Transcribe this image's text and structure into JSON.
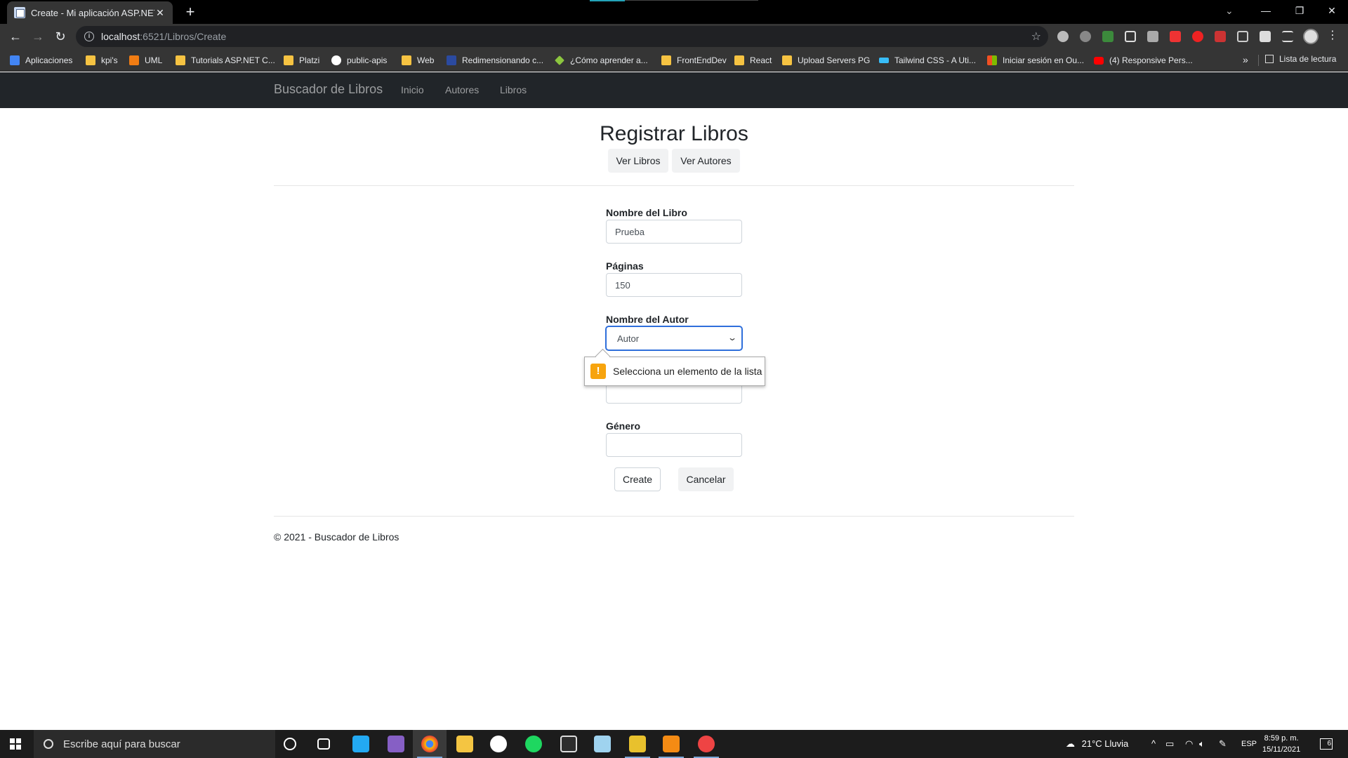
{
  "browser": {
    "tab_title": "Create - Mi aplicación ASP.NET",
    "tab_close": "✕",
    "new_tab": "+",
    "url_host": "localhost",
    "url_rest": ":6521/Libros/Create",
    "bookmarks": [
      {
        "label": "Aplicaciones",
        "icon": "apps-grid-icon",
        "color": "#4285f4"
      },
      {
        "label": "kpi's",
        "icon": "folder-icon",
        "color": "#f6c342"
      },
      {
        "label": "UML",
        "icon": "uml-icon",
        "color": "#f07c13"
      },
      {
        "label": "Tutorials ASP.NET C...",
        "icon": "folder-icon",
        "color": "#f6c342"
      },
      {
        "label": "Platzi",
        "icon": "folder-icon",
        "color": "#f6c342"
      },
      {
        "label": "public-apis",
        "icon": "github-icon",
        "color": "#ffffff"
      },
      {
        "label": "Web",
        "icon": "folder-icon",
        "color": "#f6c342"
      },
      {
        "label": "Redimensionando c...",
        "icon": "site-icon",
        "color": "#2b4aa0"
      },
      {
        "label": "¿Cómo aprender a...",
        "icon": "diamond-icon",
        "color": "#8cc63f"
      },
      {
        "label": "FrontEndDev",
        "icon": "folder-icon",
        "color": "#f6c342"
      },
      {
        "label": "React",
        "icon": "folder-icon",
        "color": "#f6c342"
      },
      {
        "label": "Upload Servers PG",
        "icon": "folder-icon",
        "color": "#f6c342"
      },
      {
        "label": "Tailwind CSS - A Uti...",
        "icon": "tailwind-icon",
        "color": "#38bdf8"
      },
      {
        "label": "Iniciar sesión en Ou...",
        "icon": "microsoft-icon",
        "color": "#f25022"
      },
      {
        "label": "(4) Responsive Pers...",
        "icon": "youtube-icon",
        "color": "#ff0000"
      }
    ],
    "more": "»",
    "reading_list": "Lista de lectura"
  },
  "site": {
    "brand": "Buscador de Libros",
    "nav": [
      "Inicio",
      "Autores",
      "Libros"
    ]
  },
  "page": {
    "title": "Registrar Libros",
    "btn_ver_libros": "Ver Libros",
    "btn_ver_autores": "Ver Autores"
  },
  "form": {
    "nombre_label": "Nombre del Libro",
    "nombre_value": "Prueba",
    "paginas_label": "Páginas",
    "paginas_value": "150",
    "autor_label": "Nombre del Autor",
    "autor_value": "Autor",
    "genero_label": "Género",
    "genero_value": "",
    "validation_message": "Selecciona un elemento de la lista",
    "create_label": "Create",
    "cancel_label": "Cancelar"
  },
  "footer": {
    "text": "© 2021 - Buscador de Libros"
  },
  "taskbar": {
    "search_placeholder": "Escribe aquí para buscar",
    "weather": "21°C  Lluvia",
    "lang": "ESP",
    "time": "8:59 p. m.",
    "date": "15/11/2021",
    "notifications": "6"
  }
}
